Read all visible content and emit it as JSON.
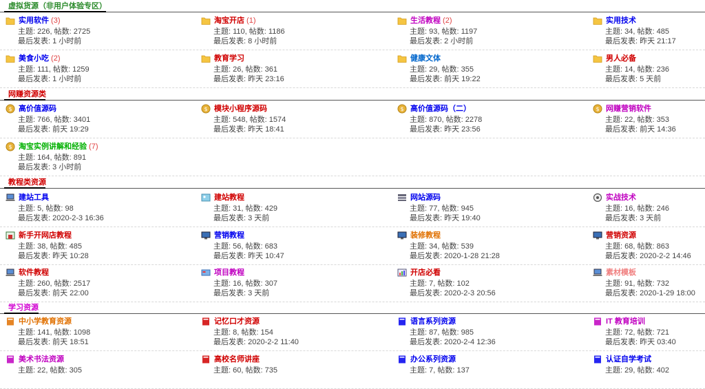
{
  "labels": {
    "topics": "主题: ",
    "posts": "帖数: ",
    "last": "最后发表: "
  },
  "sections": [
    {
      "title": "虚拟货源（非用户体验专区）",
      "color": "#2a8a2a"
    },
    {
      "title": "网赚资源类",
      "color": "#d00000"
    },
    {
      "title": "教程类资源",
      "color": "#d00000"
    },
    {
      "title": "学习资源",
      "color": "#d000d0"
    }
  ],
  "forums": [
    [
      {
        "name": "实用软件",
        "count": "(3)",
        "topics": "226",
        "posts": "2725",
        "last": "1 小时前",
        "icon": "folder-icon",
        "color": "#0000ee"
      },
      {
        "name": "淘宝开店",
        "count": "(1)",
        "topics": "110",
        "posts": "1186",
        "last": "8 小时前",
        "icon": "folder-icon",
        "color": "#d00000"
      },
      {
        "name": "生活教程",
        "count": "(2)",
        "topics": "93",
        "posts": "1197",
        "last": "2 小时前",
        "icon": "folder-icon",
        "color": "#c000c0"
      },
      {
        "name": "实用技术",
        "count": "",
        "topics": "34",
        "posts": "485",
        "last": "昨天 21:17",
        "icon": "folder-icon",
        "color": "#0000ee"
      }
    ],
    [
      {
        "name": "美食小吃",
        "count": "(2)",
        "topics": "111",
        "posts": "1259",
        "last": "1 小时前",
        "icon": "folder-icon",
        "color": "#0000ee"
      },
      {
        "name": "教育学习",
        "count": "",
        "topics": "26",
        "posts": "361",
        "last": "昨天 23:16",
        "icon": "folder-icon",
        "color": "#d00000"
      },
      {
        "name": "健康文体",
        "count": "",
        "topics": "29",
        "posts": "355",
        "last": "前天 19:22",
        "icon": "folder-icon",
        "color": "#0066cc"
      },
      {
        "name": "男人必备",
        "count": "",
        "topics": "14",
        "posts": "236",
        "last": "5 天前",
        "icon": "folder-icon",
        "color": "#d00000"
      }
    ],
    [
      {
        "name": "高价值源码",
        "count": "",
        "topics": "766",
        "posts": "3401",
        "last": "前天 19:29",
        "icon": "coin-icon",
        "color": "#0000ee"
      },
      {
        "name": "模块小程序源码",
        "count": "",
        "topics": "548",
        "posts": "1574",
        "last": "昨天 18:41",
        "icon": "coin-icon",
        "color": "#d00000"
      },
      {
        "name": "高价值源码（二）",
        "count": "",
        "topics": "870",
        "posts": "2278",
        "last": "昨天 23:56",
        "icon": "coin-icon",
        "color": "#0000ee"
      },
      {
        "name": "网赚营销软件",
        "count": "",
        "topics": "22",
        "posts": "353",
        "last": "前天 14:36",
        "icon": "coin-icon",
        "color": "#c000c0"
      }
    ],
    [
      {
        "name": "淘宝实例讲解和经验",
        "count": "(7)",
        "topics": "164",
        "posts": "891",
        "last": "3 小时前",
        "icon": "coin-icon",
        "color": "#00b000"
      }
    ],
    [
      {
        "name": "建站工具",
        "count": "",
        "topics": "5",
        "posts": "98",
        "last": "2020-2-3 16:36",
        "icon": "laptop-icon",
        "color": "#0000ee"
      },
      {
        "name": "建站教程",
        "count": "",
        "topics": "31",
        "posts": "429",
        "last": "3 天前",
        "icon": "picture-icon",
        "color": "#d00000"
      },
      {
        "name": "网站源码",
        "count": "",
        "topics": "77",
        "posts": "945",
        "last": "昨天 19:40",
        "icon": "server-icon",
        "color": "#0000ee"
      },
      {
        "name": "实战技术",
        "count": "",
        "topics": "16",
        "posts": "246",
        "last": "3 天前",
        "icon": "gear-icon",
        "color": "#c000c0"
      }
    ],
    [
      {
        "name": "新手开网店教程",
        "count": "",
        "topics": "38",
        "posts": "485",
        "last": "昨天 10:28",
        "icon": "shop-icon",
        "color": "#d00000"
      },
      {
        "name": "营销教程",
        "count": "",
        "topics": "56",
        "posts": "683",
        "last": "昨天 10:47",
        "icon": "monitor-icon",
        "color": "#0000ee"
      },
      {
        "name": "装修教程",
        "count": "",
        "topics": "34",
        "posts": "539",
        "last": "2020-1-28 21:28",
        "icon": "monitor-icon",
        "color": "#e07000"
      },
      {
        "name": "营销资源",
        "count": "",
        "topics": "68",
        "posts": "863",
        "last": "2020-2-2 14:46",
        "icon": "monitor-icon",
        "color": "#d00000"
      }
    ],
    [
      {
        "name": "软件教程",
        "count": "",
        "topics": "260",
        "posts": "2517",
        "last": "前天 22:00",
        "icon": "laptop-icon",
        "color": "#d00000"
      },
      {
        "name": "项目教程",
        "count": "",
        "topics": "16",
        "posts": "307",
        "last": "3 天前",
        "icon": "card-icon",
        "color": "#c000c0"
      },
      {
        "name": "开店必看",
        "count": "",
        "topics": "7",
        "posts": "102",
        "last": "2020-2-3 20:56",
        "icon": "chart-icon",
        "color": "#d00000"
      },
      {
        "name": "素材模板",
        "count": "",
        "topics": "91",
        "posts": "732",
        "last": "2020-1-29 18:00",
        "icon": "laptop-icon",
        "color": "#f08080"
      }
    ],
    [
      {
        "name": "中小学教育资源",
        "count": "",
        "topics": "141",
        "posts": "1098",
        "last": "前天 18:51",
        "icon": "book-icon",
        "color": "#e07000"
      },
      {
        "name": "记忆口才资源",
        "count": "",
        "topics": "8",
        "posts": "154",
        "last": "2020-2-2 11:40",
        "icon": "book-icon",
        "color": "#d00000"
      },
      {
        "name": "语言系列资源",
        "count": "",
        "topics": "87",
        "posts": "985",
        "last": "2020-2-4 12:36",
        "icon": "book-icon",
        "color": "#0000ee"
      },
      {
        "name": "IT 教育培训",
        "count": "",
        "topics": "72",
        "posts": "721",
        "last": "昨天 03:40",
        "icon": "book-icon",
        "color": "#c000c0"
      }
    ],
    [
      {
        "name": "美术书法资源",
        "count": "",
        "topics": "22",
        "posts": "305",
        "last": "",
        "icon": "book-icon",
        "color": "#c000c0"
      },
      {
        "name": "高校名师讲座",
        "count": "",
        "topics": "60",
        "posts": "735",
        "last": "",
        "icon": "book-icon",
        "color": "#d00000"
      },
      {
        "name": "办公系列资源",
        "count": "",
        "topics": "7",
        "posts": "137",
        "last": "",
        "icon": "book-icon",
        "color": "#0000ee"
      },
      {
        "name": "认证自学考试",
        "count": "",
        "topics": "29",
        "posts": "402",
        "last": "",
        "icon": "book-icon",
        "color": "#0000ee"
      }
    ]
  ]
}
